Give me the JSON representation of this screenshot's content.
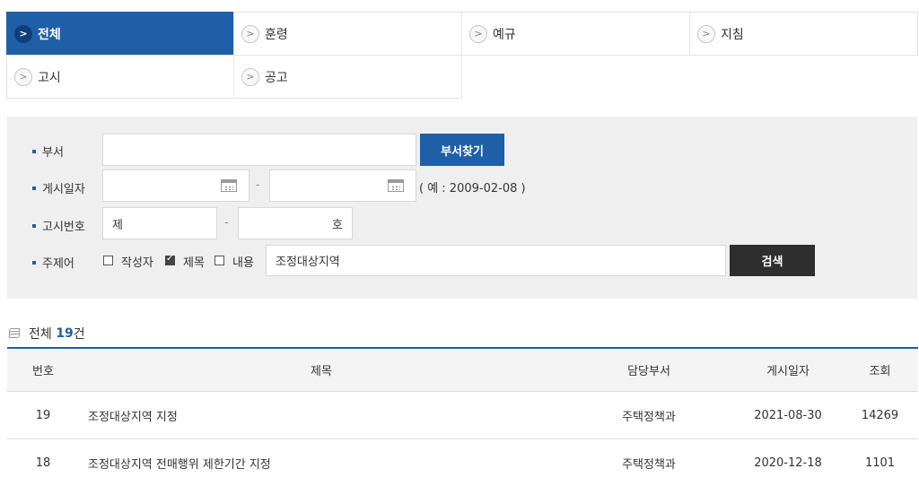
{
  "tabs": [
    {
      "label": "전체",
      "active": true
    },
    {
      "label": "훈령",
      "active": false
    },
    {
      "label": "예규",
      "active": false
    },
    {
      "label": "지침",
      "active": false
    },
    {
      "label": "고시",
      "active": false
    },
    {
      "label": "공고",
      "active": false
    }
  ],
  "search": {
    "dept_label": "부서",
    "dept_value": "",
    "dept_button": "부서찾기",
    "date_label": "게시일자",
    "date_from": "",
    "date_to": "",
    "date_sep": "-",
    "date_hint": "( 예 : 2009-02-08 )",
    "notice_label": "고시번호",
    "notice_prefix": "제",
    "notice_sep": "-",
    "notice_suffix": "호",
    "subject_label": "주제어",
    "checkboxes": [
      {
        "label": "작성자",
        "checked": false
      },
      {
        "label": "제목",
        "checked": true
      },
      {
        "label": "내용",
        "checked": false
      }
    ],
    "keyword": "조정대상지역",
    "search_button": "검색"
  },
  "summary": {
    "prefix": "전체",
    "count": "19",
    "suffix": "건"
  },
  "table": {
    "headers": {
      "num": "번호",
      "title": "제목",
      "dept": "담당부서",
      "date": "게시일자",
      "views": "조회"
    },
    "rows": [
      {
        "num": "19",
        "title": "조정대상지역 지정",
        "dept": "주택정책과",
        "date": "2021-08-30",
        "views": "14269"
      },
      {
        "num": "18",
        "title": "조정대상지역 전매행위 제한기간 지정",
        "dept": "주택정책과",
        "date": "2020-12-18",
        "views": "1101"
      }
    ]
  },
  "colors": {
    "accent": "#1f5fa8",
    "dark_button": "#2e2e2e",
    "panel_bg": "#efefef"
  }
}
